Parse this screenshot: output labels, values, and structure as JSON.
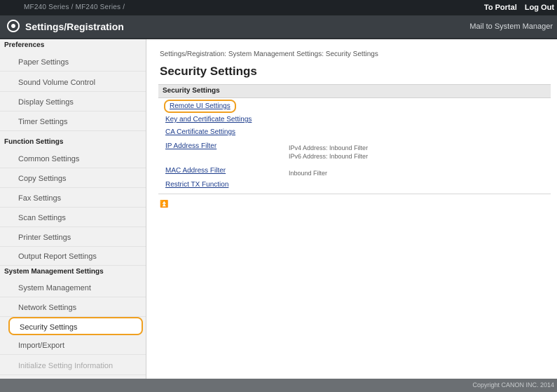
{
  "topbar": {
    "device": "MF240 Series / MF240 Series /",
    "to_portal": "To Portal",
    "log_out": "Log Out"
  },
  "header": {
    "title": "Settings/Registration",
    "mail": "Mail to System Manager"
  },
  "sidebar": {
    "sections": [
      {
        "title": "Preferences",
        "items": [
          "Paper Settings",
          "Sound Volume Control",
          "Display Settings",
          "Timer Settings"
        ]
      },
      {
        "title": "Function Settings",
        "items": [
          "Common Settings",
          "Copy Settings",
          "Fax Settings",
          "Scan Settings",
          "Printer Settings",
          "Output Report Settings"
        ]
      },
      {
        "title": "System Management Settings",
        "items": [
          "System Management",
          "Network Settings",
          "Security Settings",
          "Import/Export",
          "Initialize Setting Information"
        ]
      }
    ]
  },
  "main": {
    "breadcrumb": "Settings/Registration: System Management Settings: Security Settings",
    "title": "Security Settings",
    "section_header": "Security Settings",
    "links": [
      {
        "label": "Remote UI Settings"
      },
      {
        "label": "Key and Certificate Settings"
      },
      {
        "label": "CA Certificate Settings"
      },
      {
        "label": "IP Address Filter",
        "desc": [
          "IPv4 Address: Inbound Filter",
          "IPv6 Address: Inbound Filter"
        ]
      },
      {
        "label": "MAC Address Filter",
        "desc": [
          "Inbound Filter"
        ]
      },
      {
        "label": "Restrict TX Function"
      }
    ],
    "top_icon": "⏫"
  },
  "footer": {
    "copyright": "Copyright CANON INC. 2014"
  },
  "colors": {
    "highlight": "#f0a020",
    "link": "#1c3c8c"
  }
}
